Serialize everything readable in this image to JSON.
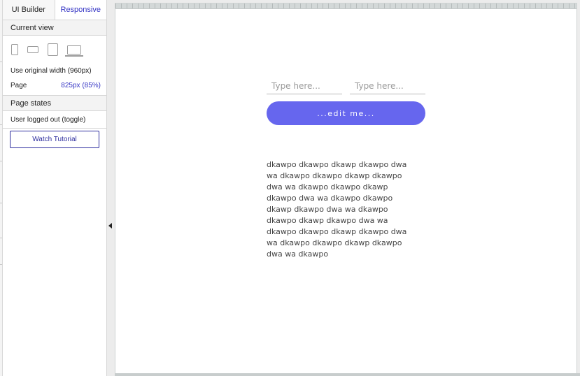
{
  "sidebar": {
    "tabs": [
      {
        "label": "UI Builder"
      },
      {
        "label": "Responsive"
      }
    ],
    "current_view": {
      "heading": "Current view",
      "devices": [
        "phone-portrait-icon",
        "phone-landscape-icon",
        "tablet-icon",
        "laptop-icon"
      ],
      "original_width_label": "Use original width (960px)",
      "page_label": "Page",
      "page_value": "825px (85%)"
    },
    "page_states": {
      "heading": "Page states",
      "state_label": "User logged out (toggle)"
    },
    "watch_button": "Watch Tutorial"
  },
  "canvas": {
    "input1_placeholder": "Type here...",
    "input2_placeholder": "Type here...",
    "edit_button": "...edit me...",
    "paragraph": "dkawpo dkawpo dkawp dkawpo dwa wa dkawpo dkawpo dkawp dkawpo dwa wa dkawpo dkawpo dkawp dkawpo dwa wa dkawpo dkawpo dkawp dkawpo dwa wa dkawpo dkawpo dkawp dkawpo dwa wa dkawpo dkawpo dkawp dkawpo dwa wa dkawpo dkawpo dkawp dkawpo dwa wa dkawpo"
  },
  "colors": {
    "accent": "#3434c4",
    "button": "#6666ee",
    "ruler": "#d3d8d8"
  }
}
